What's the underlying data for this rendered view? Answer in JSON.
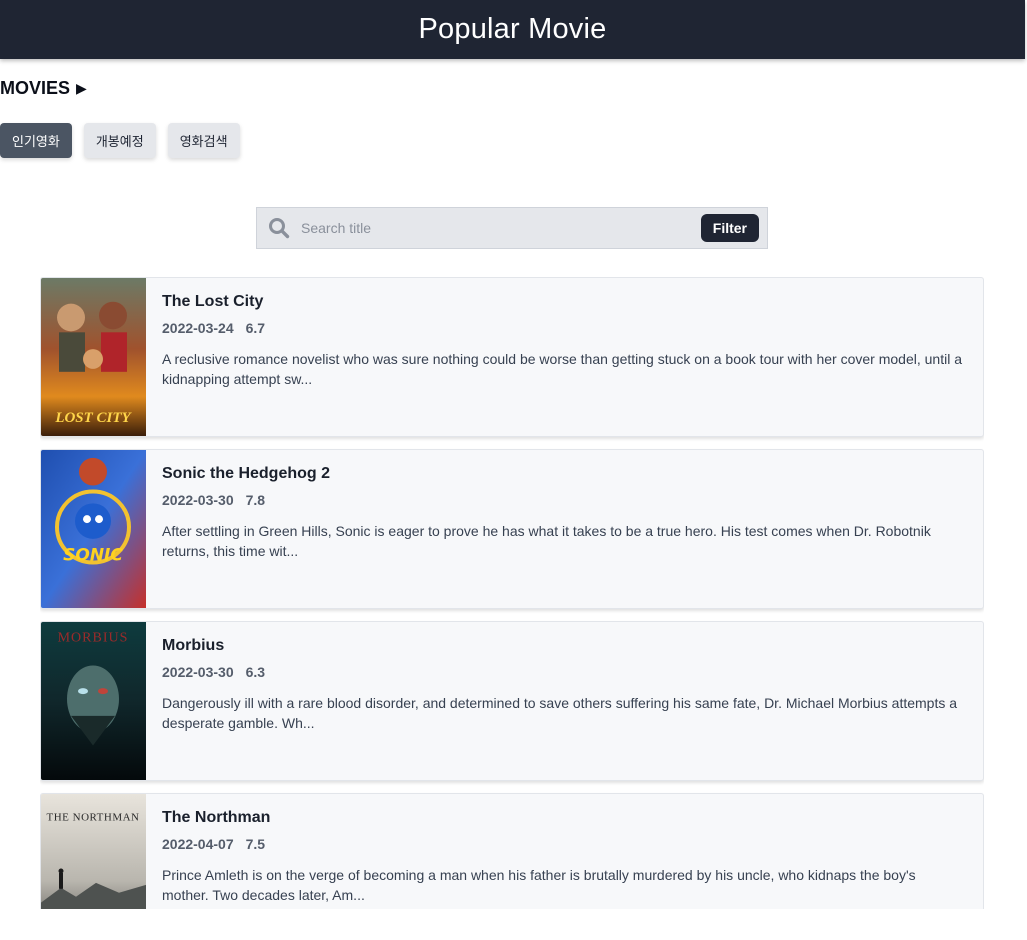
{
  "header": {
    "title": "Popular Movie"
  },
  "section": {
    "title": "MOVIES",
    "arrow": "▶"
  },
  "tabs": [
    {
      "label": "인기영화",
      "active": true
    },
    {
      "label": "개봉예정",
      "active": false
    },
    {
      "label": "영화검색",
      "active": false
    }
  ],
  "search": {
    "placeholder": "Search title",
    "value": "",
    "button_label": "Filter",
    "icon": "search-icon"
  },
  "movies": [
    {
      "title": "The Lost City",
      "date": "2022-03-24",
      "rating": "6.7",
      "overview": "A reclusive romance novelist who was sure nothing could be worse than getting stuck on a book tour with her cover model, until a kidnapping attempt sw...",
      "poster_text": "LOST CITY"
    },
    {
      "title": "Sonic the Hedgehog 2",
      "date": "2022-03-30",
      "rating": "7.8",
      "overview": "After settling in Green Hills, Sonic is eager to prove he has what it takes to be a true hero. His test comes when Dr. Robotnik returns, this time wit...",
      "poster_text": "SONIC"
    },
    {
      "title": "Morbius",
      "date": "2022-03-30",
      "rating": "6.3",
      "overview": "Dangerously ill with a rare blood disorder, and determined to save others suffering his same fate, Dr. Michael Morbius attempts a desperate gamble. Wh...",
      "poster_text": "MORBIUS"
    },
    {
      "title": "The Northman",
      "date": "2022-04-07",
      "rating": "7.5",
      "overview": "Prince Amleth is on the verge of becoming a man when his father is brutally murdered by his uncle, who kidnaps the boy's mother. Two decades later, Am...",
      "poster_text": "THE NORTHMAN"
    }
  ],
  "colors": {
    "header_bg": "#1f2533",
    "tab_active_bg": "#4b5563",
    "tab_bg": "#e5e7eb",
    "card_bg": "#f7f8fa"
  }
}
